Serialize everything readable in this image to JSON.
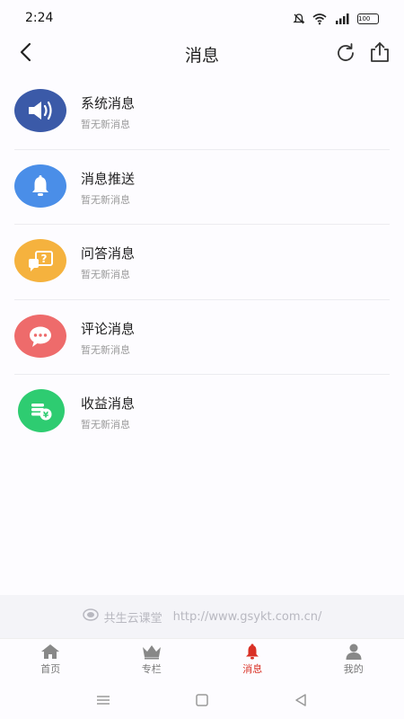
{
  "status_bar": {
    "time": "2:24",
    "battery": "100"
  },
  "header": {
    "title": "消息"
  },
  "messages": [
    {
      "title": "系统消息",
      "subtitle": "暂无新消息",
      "icon": "speaker-icon",
      "color": "#3b5aa8"
    },
    {
      "title": "消息推送",
      "subtitle": "暂无新消息",
      "icon": "bell-icon",
      "color": "#4a8ee8"
    },
    {
      "title": "问答消息",
      "subtitle": "暂无新消息",
      "icon": "question-chat-icon",
      "color": "#f5b23e"
    },
    {
      "title": "评论消息",
      "subtitle": "暂无新消息",
      "icon": "comment-icon",
      "color": "#ee6b6b"
    },
    {
      "title": "收益消息",
      "subtitle": "暂无新消息",
      "icon": "coins-icon",
      "color": "#2ecc71"
    }
  ],
  "footer": {
    "brand": "共生云课堂",
    "url": "http://www.gsykt.com.cn/"
  },
  "tabs": [
    {
      "label": "首页",
      "icon": "home-icon"
    },
    {
      "label": "专栏",
      "icon": "crown-icon"
    },
    {
      "label": "消息",
      "icon": "bell-icon",
      "active": true
    },
    {
      "label": "我的",
      "icon": "user-icon"
    }
  ],
  "colors": {
    "active_tab": "#d93025",
    "background": "#fdfcff"
  }
}
